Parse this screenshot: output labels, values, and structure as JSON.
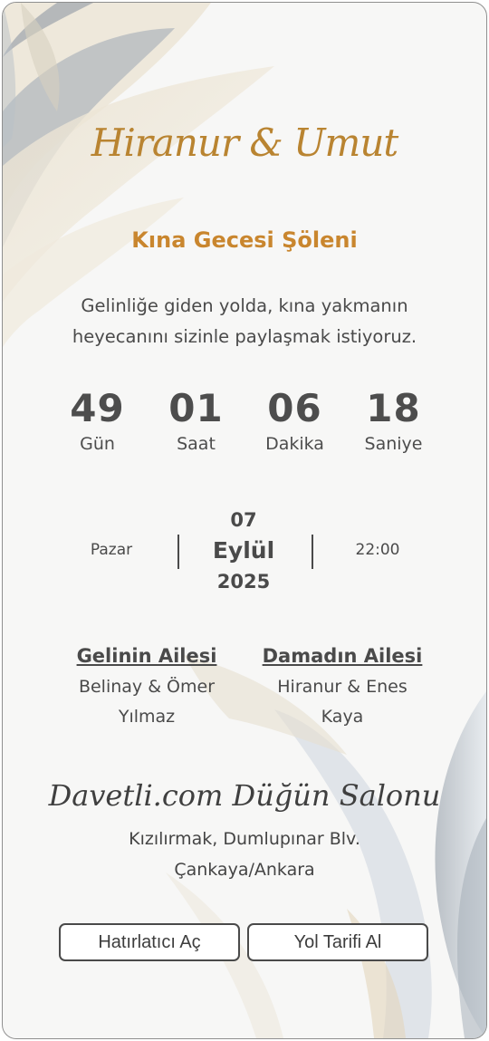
{
  "couple": {
    "names": "Hiranur & Umut"
  },
  "event": {
    "title": "Kına Gecesi Şöleni",
    "intro": "Gelinliğe giden yolda, kına yakmanın heyecanını sizinle paylaşmak istiyoruz."
  },
  "countdown": [
    {
      "value": "49",
      "label": "Gün"
    },
    {
      "value": "01",
      "label": "Saat"
    },
    {
      "value": "06",
      "label": "Dakika"
    },
    {
      "value": "18",
      "label": "Saniye"
    }
  ],
  "date": {
    "weekday": "Pazar",
    "day": "07",
    "month": "Eylül",
    "year": "2025",
    "time": "22:00"
  },
  "families": {
    "bride": {
      "title": "Gelinin Ailesi",
      "names": "Belinay & Ömer Yılmaz"
    },
    "groom": {
      "title": "Damadın Ailesi",
      "names": "Hiranur & Enes Kaya"
    }
  },
  "venue": {
    "name": "Davetli.com Düğün Salonu",
    "address": "Kızılırmak, Dumlupınar Blv. Çankaya/Ankara"
  },
  "buttons": {
    "reminder": "Hatırlatıcı Aç",
    "directions": "Yol Tarifi Al"
  },
  "colors": {
    "accent": "#c9862e",
    "text": "#4a4a4a",
    "background": "#f7f7f6"
  }
}
